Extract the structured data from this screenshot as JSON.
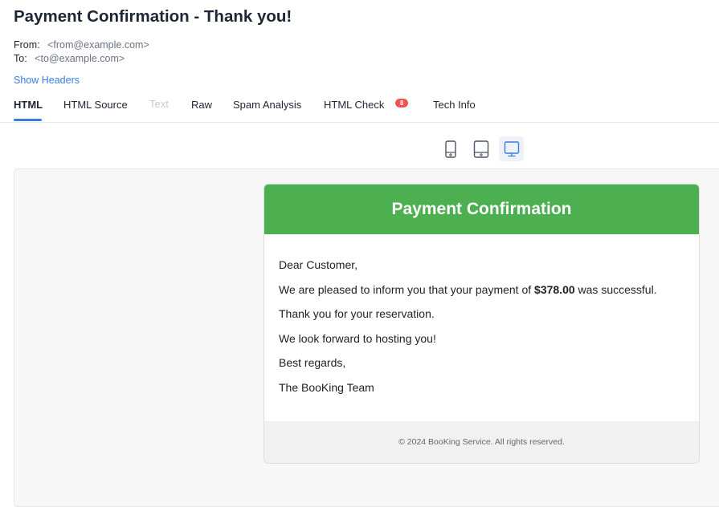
{
  "message": {
    "subject": "Payment Confirmation - Thank you!",
    "from_label": "From:",
    "from_value": "<from@example.com>",
    "to_label": "To:",
    "to_value": "<to@example.com>",
    "show_headers": "Show Headers"
  },
  "tabs": [
    {
      "label": "HTML",
      "active": true
    },
    {
      "label": "HTML Source"
    },
    {
      "label": "Text",
      "disabled": true
    },
    {
      "label": "Raw"
    },
    {
      "label": "Spam Analysis"
    },
    {
      "label": "HTML Check",
      "badge": "8"
    },
    {
      "label": "Tech Info"
    }
  ],
  "devices": [
    {
      "icon": "mobile-icon"
    },
    {
      "icon": "tablet-icon"
    },
    {
      "icon": "desktop-icon",
      "active": true
    }
  ],
  "email": {
    "header_title": "Payment Confirmation",
    "greeting": "Dear Customer,",
    "line1_prefix": "We are pleased to inform you that your payment of ",
    "amount": "$378.00",
    "line1_suffix": " was successful.",
    "line2": "Thank you for your reservation.",
    "line3": "We look forward to hosting you!",
    "sign_off": "Best regards,",
    "team": "The BooKing Team",
    "footer": "© 2024 BooKing Service. All rights reserved.",
    "header_color": "#4caf50"
  },
  "colors": {
    "accent": "#3b7ddd",
    "badge": "#f05252"
  }
}
